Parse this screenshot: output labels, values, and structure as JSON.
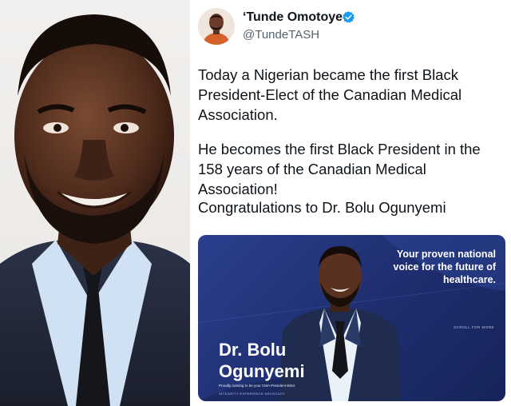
{
  "tweet": {
    "author_name": "‘Tunde Omotoye",
    "handle": "@TundeTASH",
    "paragraphs": [
      "Today a Nigerian became the first Black President-Elect of the Canadian Medical Association.",
      "He becomes the first Black President in the 158 years of the Canadian Medical Association!",
      "Congratulations to Dr. Bolu Ogunyemi"
    ]
  },
  "banner": {
    "tagline": "Your proven national voice for the future of healthcare.",
    "scroll_note": "SCROLL FOR MORE",
    "name_line1": "Dr. Bolu",
    "name_line2": "Ogunyemi",
    "subtitle": "Proudly running to be your CMA President-Elect",
    "values": "INTEGRITY  EXPERIENCE  ADVOCACY"
  },
  "colors": {
    "banner_blue": "#1e2d6e",
    "verified_blue": "#1d9bf0",
    "text_primary": "#0f1419",
    "text_secondary": "#536471"
  },
  "icons": {
    "verified": "verified-badge-icon"
  }
}
